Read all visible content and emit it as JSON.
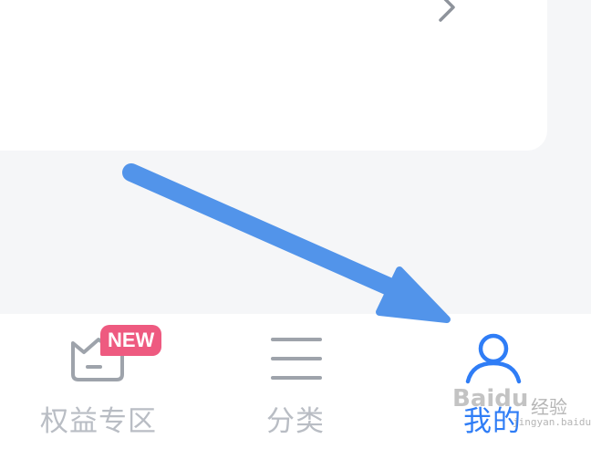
{
  "card": {
    "chevron_icon": "chevron-right-icon"
  },
  "tabs": [
    {
      "id": "benefits",
      "label": "权益专区",
      "icon": "basket-icon",
      "badge": "NEW",
      "active": false
    },
    {
      "id": "category",
      "label": "分类",
      "icon": "menu-icon",
      "active": false
    },
    {
      "id": "mine",
      "label": "我的",
      "icon": "person-icon",
      "active": true
    }
  ],
  "annotation": {
    "arrow_color": "#5294ea",
    "points_to": "mine"
  },
  "colors": {
    "active": "#2f7df6",
    "inactive": "#b9bdc4",
    "badge": "#ee5a80"
  },
  "watermark": {
    "text": "Baidu",
    "sub": "经验",
    "url": "jingyan.baidu.com"
  }
}
